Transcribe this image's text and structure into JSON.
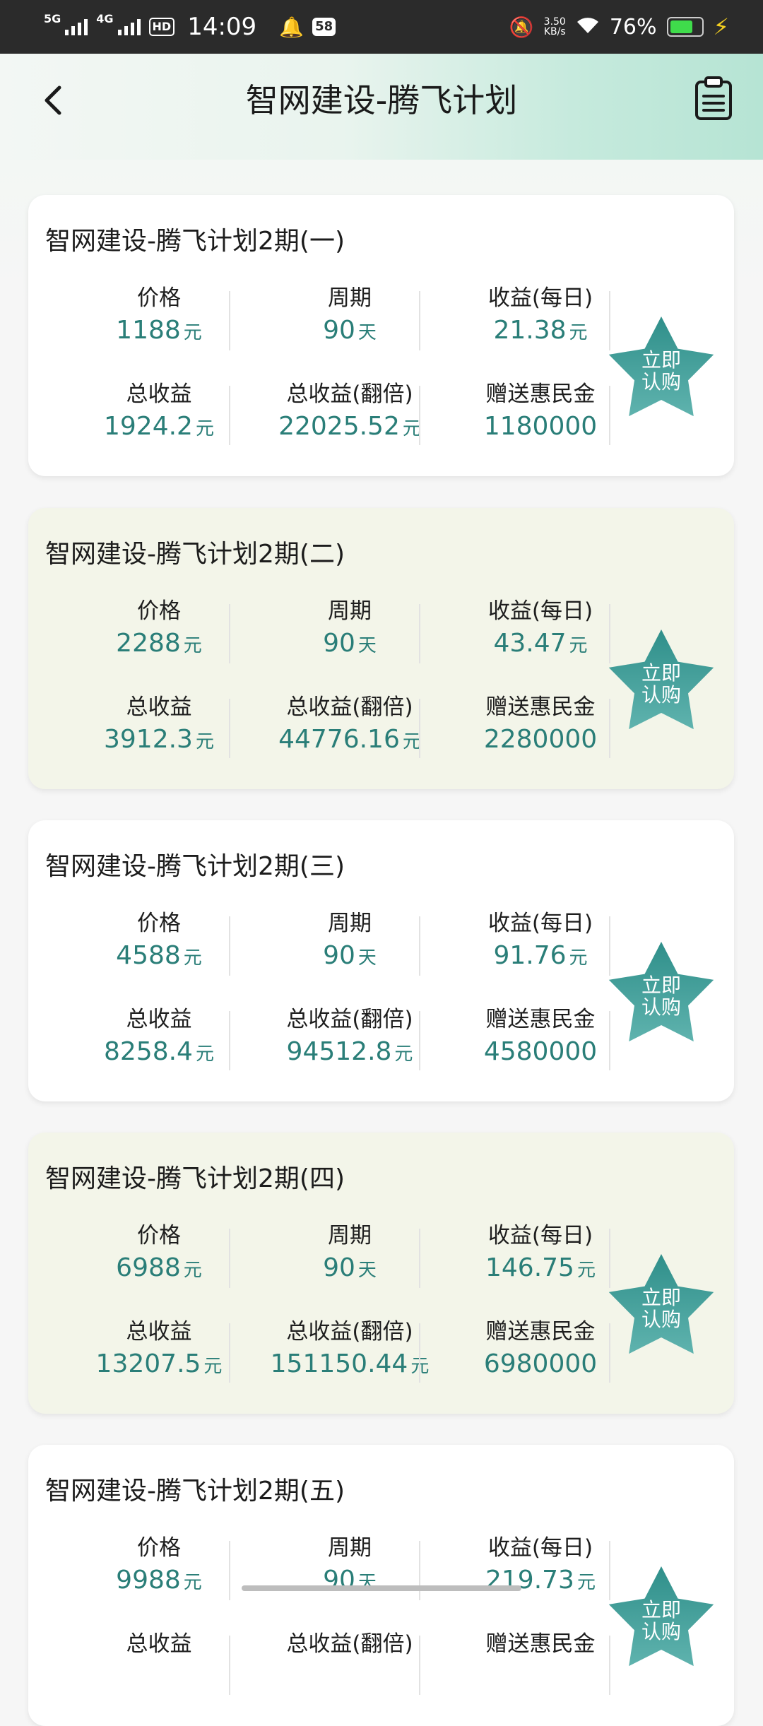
{
  "status_bar": {
    "signal1": "5G",
    "signal2": "4G",
    "hd": "HD",
    "time": "14:09",
    "notif_badge": "58",
    "speed_value": "3.50",
    "speed_unit": "KB/s",
    "battery_pct": "76%",
    "battery_level": 0.76
  },
  "header": {
    "title": "智网建设-腾飞计划"
  },
  "labels": {
    "price": "价格",
    "cycle": "周期",
    "daily": "收益(每日)",
    "total": "总收益",
    "double": "总收益(翻倍)",
    "gift": "赠送惠民金",
    "yuan": "元",
    "day": "天",
    "buy_line1": "立即",
    "buy_line2": "认购"
  },
  "products": [
    {
      "title": "智网建设-腾飞计划2期(一)",
      "price": "1188",
      "cycle": "90",
      "daily": "21.38",
      "total": "1924.2",
      "double": "22025.52",
      "gift": "1180000"
    },
    {
      "title": "智网建设-腾飞计划2期(二)",
      "price": "2288",
      "cycle": "90",
      "daily": "43.47",
      "total": "3912.3",
      "double": "44776.16",
      "gift": "2280000"
    },
    {
      "title": "智网建设-腾飞计划2期(三)",
      "price": "4588",
      "cycle": "90",
      "daily": "91.76",
      "total": "8258.4",
      "double": "94512.8",
      "gift": "4580000"
    },
    {
      "title": "智网建设-腾飞计划2期(四)",
      "price": "6988",
      "cycle": "90",
      "daily": "146.75",
      "total": "13207.5",
      "double": "151150.44",
      "gift": "6980000"
    },
    {
      "title": "智网建设-腾飞计划2期(五)",
      "price": "9988",
      "cycle": "90",
      "daily": "219.73",
      "total": "",
      "double": "",
      "gift": ""
    }
  ],
  "colors": {
    "value_teal": "#2a7e78",
    "star_top": "#2f8f8a",
    "star_bottom": "#5fb3ae"
  }
}
